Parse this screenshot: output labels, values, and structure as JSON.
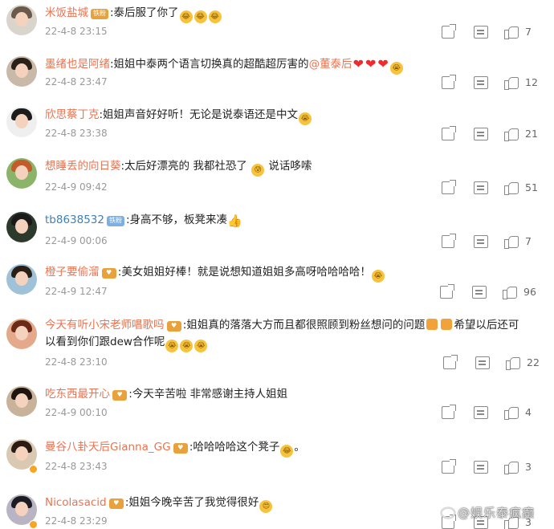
{
  "comments": [
    {
      "username": "米饭盐城",
      "name_color": "orange",
      "badge_type": "fan",
      "badge_text": "铁粉",
      "segments": [
        {
          "t": "text",
          "v": ":泰后服了你了"
        },
        {
          "t": "emo",
          "v": "😂"
        },
        {
          "t": "emo",
          "v": "😂"
        },
        {
          "t": "emo",
          "v": "😂"
        }
      ],
      "time": "22-4-8 23:15",
      "likes": "7",
      "avatar_hair": "#6b5a4a",
      "avatar_bg": "#d9d4cc",
      "verified": false
    },
    {
      "username": "墨绪也是阿绪",
      "name_color": "orange",
      "badge_type": "",
      "badge_text": "",
      "segments": [
        {
          "t": "text",
          "v": ":姐姐中泰两个语言切换真的超酷超厉害的"
        },
        {
          "t": "mention",
          "v": "@董泰后"
        },
        {
          "t": "heart",
          "v": "❤"
        },
        {
          "t": "heart",
          "v": "❤"
        },
        {
          "t": "heart",
          "v": "❤"
        },
        {
          "t": "emo",
          "v": "😭"
        }
      ],
      "time": "22-4-8 23:47",
      "likes": "12",
      "avatar_hair": "#2b2118",
      "avatar_bg": "#c9b9a8",
      "verified": false
    },
    {
      "username": "欣思蔡丁克",
      "name_color": "orange",
      "badge_type": "",
      "badge_text": "",
      "segments": [
        {
          "t": "text",
          "v": ":姐姐声音好好听！无论是说泰语还是中文"
        },
        {
          "t": "emo",
          "v": "😭"
        }
      ],
      "time": "22-4-8 23:38",
      "likes": "21",
      "avatar_hair": "#1c1c1c",
      "avatar_bg": "#efefef",
      "verified": false
    },
    {
      "username": "想睡丢的向日葵",
      "name_color": "orange",
      "badge_type": "",
      "badge_text": "",
      "segments": [
        {
          "t": "text",
          "v": ":太后好漂亮的 我都社恐了 "
        },
        {
          "t": "emo",
          "v": "😰"
        },
        {
          "t": "text",
          "v": " 说话哆嗦"
        }
      ],
      "time": "22-4-9 09:42",
      "likes": "51",
      "avatar_hair": "#c45b2a",
      "avatar_bg": "#8bb36a",
      "verified": false
    },
    {
      "username": "tb8638532",
      "name_color": "blue",
      "badge_type": "iron",
      "badge_text": "铁粉",
      "segments": [
        {
          "t": "text",
          "v": ":身高不够，板凳来凑"
        },
        {
          "t": "thumb",
          "v": "👍"
        }
      ],
      "time": "22-4-9 00:06",
      "likes": "7",
      "avatar_hair": "#1a1a1a",
      "avatar_bg": "#2b3a2a",
      "verified": false
    },
    {
      "username": "橙子要偷溜",
      "name_color": "orange",
      "badge_type": "fan",
      "badge_text": "",
      "segments": [
        {
          "t": "text",
          "v": ":美女姐姐好棒！就是说想知道姐姐多高呀哈哈哈哈！"
        },
        {
          "t": "emo",
          "v": "😭"
        }
      ],
      "time": "22-4-9 12:47",
      "likes": "96",
      "avatar_hair": "#2a2016",
      "avatar_bg": "#9fc2d8",
      "verified": false
    },
    {
      "username": "今天有听小宋老师唱歌吗",
      "name_color": "orange",
      "badge_type": "fan",
      "badge_text": "",
      "segments": [
        {
          "t": "text",
          "v": ":姐姐真的落落大方而且都很照顾到粉丝想问的问题"
        },
        {
          "t": "gift",
          "v": ""
        },
        {
          "t": "gift",
          "v": ""
        },
        {
          "t": "text",
          "v": "希望以后还可以看到你们跟dew合作呢"
        },
        {
          "t": "emo",
          "v": "😭"
        },
        {
          "t": "emo",
          "v": "😭"
        },
        {
          "t": "emo",
          "v": "😭"
        }
      ],
      "time": "22-4-8 23:10",
      "likes": "22",
      "avatar_hair": "#6b2a18",
      "avatar_bg": "#e3a98a",
      "verified": false
    },
    {
      "username": "吃东西最开心",
      "name_color": "orange",
      "badge_type": "fan",
      "badge_text": "",
      "segments": [
        {
          "t": "text",
          "v": ":今天辛苦啦 非常感谢主持人姐姐"
        }
      ],
      "time": "22-4-9 00:10",
      "likes": "4",
      "avatar_hair": "#1e1410",
      "avatar_bg": "#c8b39a",
      "verified": false
    },
    {
      "username": "曼谷八卦天后Gianna_GG",
      "name_color": "orange",
      "badge_type": "fan",
      "badge_text": "",
      "segments": [
        {
          "t": "text",
          "v": ":哈哈哈哈这个凳子"
        },
        {
          "t": "emo",
          "v": "😂"
        },
        {
          "t": "text",
          "v": "。"
        }
      ],
      "time": "22-4-8 23:43",
      "likes": "3",
      "avatar_hair": "#2a1c14",
      "avatar_bg": "#d9c8b2",
      "verified": true
    },
    {
      "username": "Nicolasacid",
      "name_color": "orange",
      "badge_type": "fan",
      "badge_text": "",
      "segments": [
        {
          "t": "text",
          "v": ":姐姐今晚辛苦了我觉得很好"
        },
        {
          "t": "emo",
          "v": "😍"
        }
      ],
      "time": "22-4-8 23:29",
      "likes": "3",
      "avatar_hair": "#1c1c24",
      "avatar_bg": "#b9b4c4",
      "verified": true
    }
  ],
  "watermark": "@娱乐泰疯癫"
}
